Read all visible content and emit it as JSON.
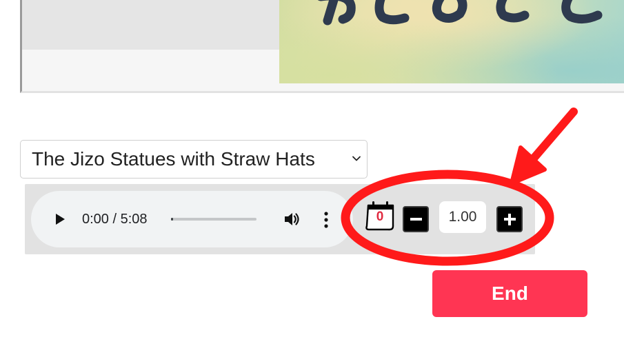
{
  "story_select": {
    "selected": "The Jizo Statues with Straw Hats"
  },
  "audio": {
    "time_display": "0:00 / 5:08",
    "progress": 0
  },
  "counter": {
    "value": "0"
  },
  "speed": {
    "value": "1.00"
  },
  "end_button": {
    "label": "End"
  },
  "icons": {
    "play": "play-icon",
    "volume": "volume-icon",
    "more": "more-vertical-icon",
    "calendar": "calendar-icon",
    "minus": "minus-icon",
    "plus": "plus-icon",
    "chevron": "chevron-down-icon"
  },
  "colors": {
    "end_button": "#ff3553",
    "counter_text": "#e02a40",
    "annotation": "#ff1a1a"
  }
}
